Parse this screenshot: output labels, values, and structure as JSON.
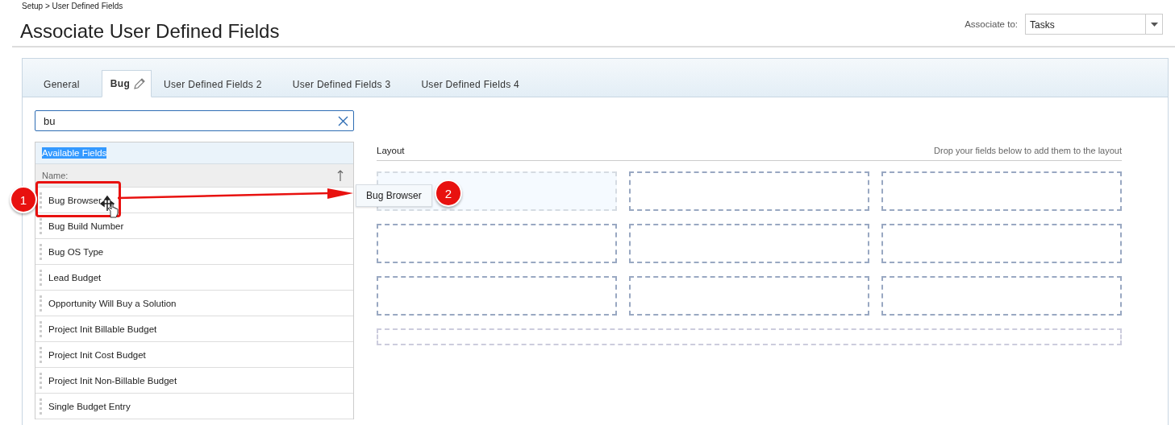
{
  "breadcrumb": "Setup > User Defined Fields",
  "title": "Associate User Defined Fields",
  "associate": {
    "label": "Associate to:",
    "value": "Tasks"
  },
  "tabs": [
    {
      "label": "General",
      "selected": false,
      "kind": "plain"
    },
    {
      "label": "Bug",
      "selected": true,
      "kind": "editable"
    },
    {
      "label": "User Defined Fields 2",
      "selected": false,
      "kind": "plain"
    },
    {
      "label": "User Defined Fields 3",
      "selected": false,
      "kind": "plain"
    },
    {
      "label": "User Defined Fields 4",
      "selected": false,
      "kind": "plain"
    }
  ],
  "search": {
    "value": "bu"
  },
  "available_fields": {
    "title": "Available Fields",
    "column": "Name:",
    "items": [
      "Bug Browser",
      "Bug Build Number",
      "Bug OS Type",
      "Lead Budget",
      "Opportunity Will Buy a Solution",
      "Project Init Billable Budget",
      "Project Init Cost Budget",
      "Project Init Non-Billable Budget",
      "Single Budget Entry"
    ]
  },
  "layout": {
    "title": "Layout",
    "hint": "Drop your fields below to add them to the layout",
    "slots": [
      {
        "kind": "cell",
        "highlighted": true
      },
      {
        "kind": "cell",
        "highlighted": false
      },
      {
        "kind": "cell",
        "highlighted": false
      },
      {
        "kind": "cell",
        "highlighted": false
      },
      {
        "kind": "cell",
        "highlighted": false
      },
      {
        "kind": "cell",
        "highlighted": false
      },
      {
        "kind": "cell",
        "highlighted": false
      },
      {
        "kind": "cell",
        "highlighted": false
      },
      {
        "kind": "cell",
        "highlighted": false
      },
      {
        "kind": "wide",
        "highlighted": false
      }
    ]
  },
  "drag_chip": "Bug Browser",
  "steps": [
    "1",
    "2"
  ]
}
